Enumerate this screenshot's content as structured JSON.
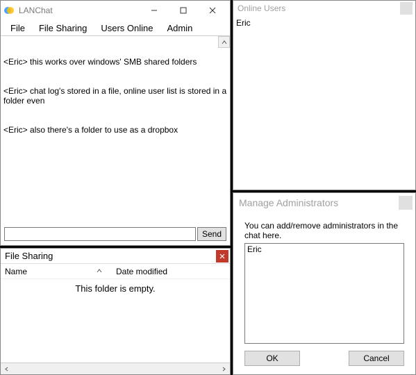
{
  "main": {
    "title": "LANChat",
    "menu": {
      "file": "File",
      "fileSharing": "File Sharing",
      "usersOnline": "Users Online",
      "admin": "Admin"
    },
    "log": [
      "<Eric> this works over windows' SMB shared folders",
      "<Eric> chat log's stored in a file, online user list is stored in a folder even",
      "<Eric> also there's a folder to use as a dropbox"
    ],
    "send": "Send"
  },
  "fs": {
    "title": "File Sharing",
    "col_name": "Name",
    "col_date": "Date modified",
    "empty": "This folder is empty."
  },
  "ou": {
    "title": "Online Users",
    "users": [
      "Eric"
    ]
  },
  "admin": {
    "title": "Manage Administrators",
    "desc": "You can add/remove administrators in the chat here.",
    "list": [
      "Eric"
    ],
    "ok": "OK",
    "cancel": "Cancel"
  }
}
